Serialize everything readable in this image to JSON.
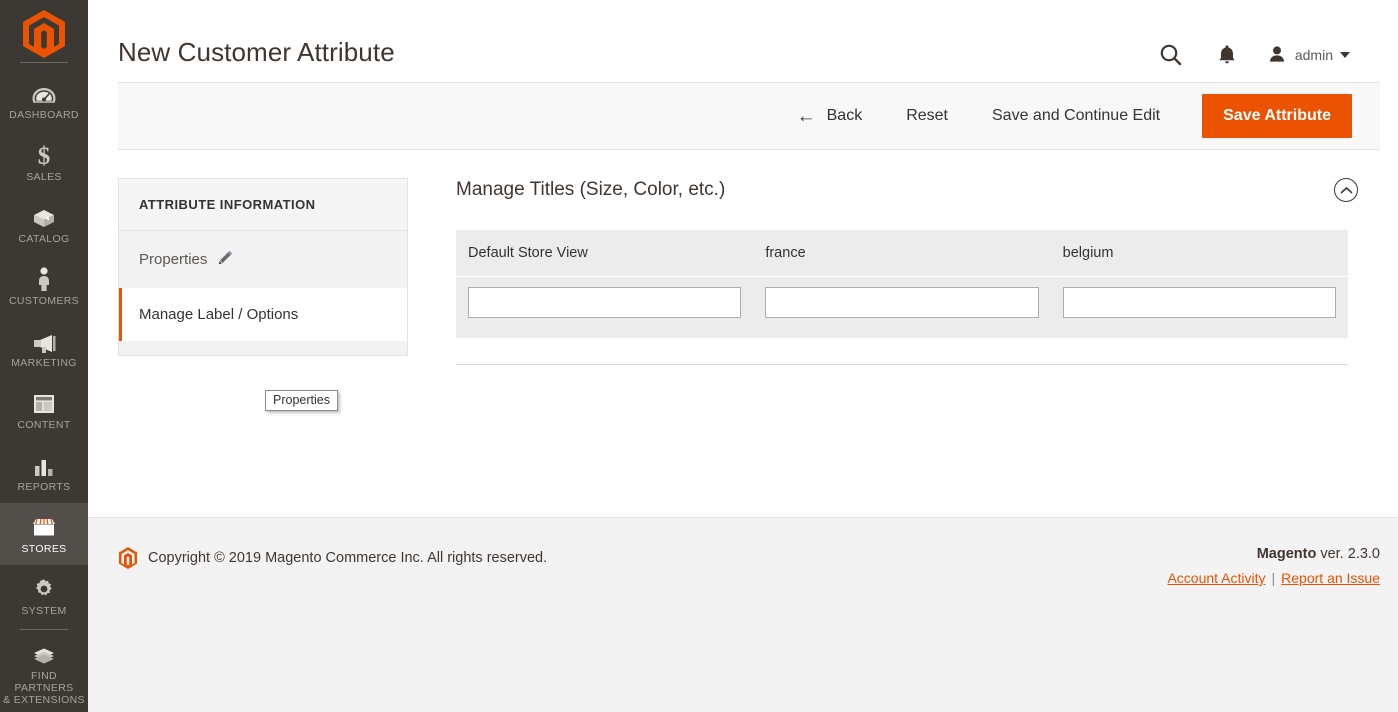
{
  "sidebar": {
    "logo": "magento-logo",
    "items": [
      {
        "label": "DASHBOARD",
        "icon": "dashboard-gauge-icon",
        "active": false
      },
      {
        "label": "SALES",
        "icon": "dollar-sign-icon",
        "active": false
      },
      {
        "label": "CATALOG",
        "icon": "box-icon",
        "active": false
      },
      {
        "label": "CUSTOMERS",
        "icon": "person-icon",
        "active": false
      },
      {
        "label": "MARKETING",
        "icon": "megaphone-icon",
        "active": false
      },
      {
        "label": "CONTENT",
        "icon": "layout-icon",
        "active": false
      },
      {
        "label": "REPORTS",
        "icon": "bar-chart-icon",
        "active": false
      },
      {
        "label": "STORES",
        "icon": "storefront-icon",
        "active": true
      },
      {
        "label": "SYSTEM",
        "icon": "gear-icon",
        "active": false
      },
      {
        "label": "FIND PARTNERS\n& EXTENSIONS",
        "icon": "extensions-box-icon",
        "active": false
      }
    ]
  },
  "header": {
    "title": "New Customer Attribute",
    "search_icon": "search-icon",
    "notifications_icon": "bell-icon",
    "user_icon": "user-avatar-icon",
    "user_name": "admin",
    "caret_icon": "chevron-down-icon"
  },
  "toolbar": {
    "back_label": "Back",
    "back_icon": "arrow-left-icon",
    "reset_label": "Reset",
    "save_continue_label": "Save and Continue Edit",
    "save_label": "Save Attribute",
    "primary_color": "#eb5202"
  },
  "left_panel": {
    "heading": "ATTRIBUTE INFORMATION",
    "items": [
      {
        "label": "Properties",
        "icon": "pencil-icon",
        "active": false
      },
      {
        "label": "Manage Label / Options",
        "icon": "",
        "active": true
      }
    ],
    "tooltip": "Properties"
  },
  "section": {
    "title": "Manage Titles (Size, Color, etc.)",
    "collapse_icon": "chevron-up-circle-icon",
    "columns": [
      "Default Store View",
      "france",
      "belgium"
    ],
    "values": [
      "",
      "",
      ""
    ],
    "placeholders": [
      "",
      "",
      ""
    ]
  },
  "footer": {
    "logo_icon": "magento-logo-icon",
    "copyright": "Copyright © 2019 Magento Commerce Inc. All rights reserved.",
    "brand": "Magento",
    "version": " ver. 2.3.0",
    "link_account": "Account Activity",
    "link_separator": "|",
    "link_report": "Report an Issue"
  }
}
